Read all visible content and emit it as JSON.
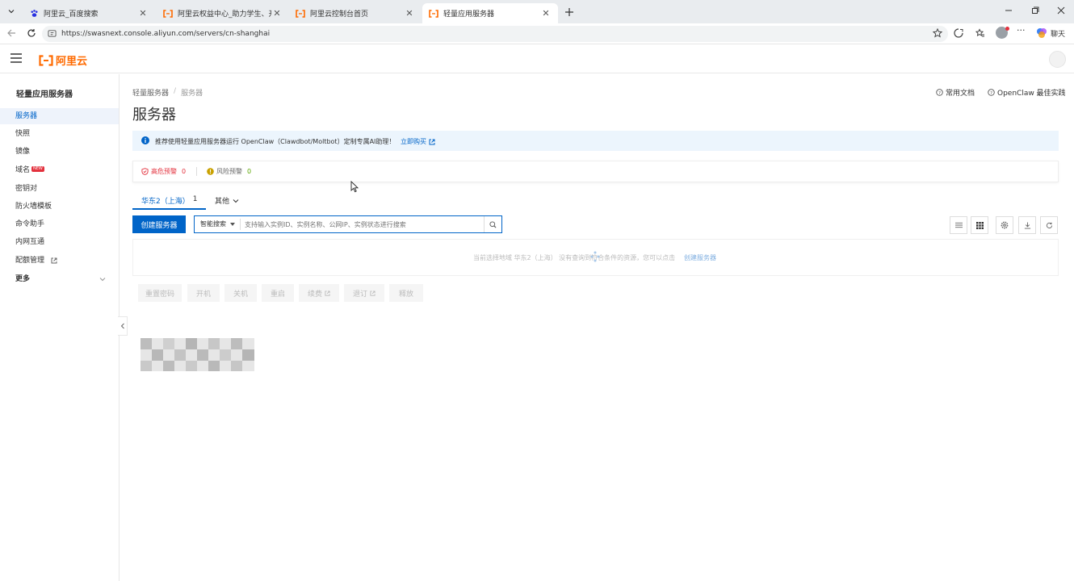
{
  "browser": {
    "tabs": [
      {
        "title": "阿里云_百度搜索"
      },
      {
        "title": "阿里云权益中心_助力学生、开发者"
      },
      {
        "title": "阿里云控制台首页"
      },
      {
        "title": "轻量应用服务器"
      }
    ],
    "url": "https://swasnext.console.aliyun.com/servers/cn-shanghai",
    "chat_label": "聊天"
  },
  "header": {
    "logo_text": "阿里云"
  },
  "sidebar": {
    "title": "轻量应用服务器",
    "items": [
      {
        "label": "服务器"
      },
      {
        "label": "快照"
      },
      {
        "label": "镜像"
      },
      {
        "label": "域名"
      },
      {
        "label": "密钥对"
      },
      {
        "label": "防火墙模板"
      },
      {
        "label": "命令助手"
      },
      {
        "label": "内网互通"
      },
      {
        "label": "配额管理"
      },
      {
        "label": "更多"
      }
    ],
    "new_badge": "NEW"
  },
  "main": {
    "breadcrumb": [
      "轻量服务器",
      "服务器"
    ],
    "title": "服务器",
    "links": {
      "docs": "常用文档",
      "best_practice": "OpenClaw 最佳实践"
    },
    "banner": {
      "text": "推荐使用轻量应用服务器运行 OpenClaw（Clawdbot/Moltbot）定制专属AI助理！",
      "link": "立即购买"
    },
    "alerts": {
      "high_label": "高危预警",
      "high_count": "0",
      "risk_label": "风险预警",
      "risk_count": "0"
    },
    "region_tabs": {
      "active": "华东2（上海）",
      "active_count": "1",
      "other": "其他"
    },
    "create_button": "创建服务器",
    "search": {
      "mode": "智能搜索",
      "placeholder": "支持输入实例ID、实例名称、公网IP、实例状态进行搜索"
    },
    "empty": {
      "text": "当前选择地域 华东2（上海） 没有查询到符合条件的资源，您可以点击",
      "link": "创建服务器"
    },
    "actions": [
      "重置密码",
      "开机",
      "关机",
      "重启",
      "续费",
      "退订",
      "释放"
    ]
  },
  "colors": {
    "accent": "#0064c8",
    "brand": "#ff6a00",
    "danger": "#e3313d"
  }
}
